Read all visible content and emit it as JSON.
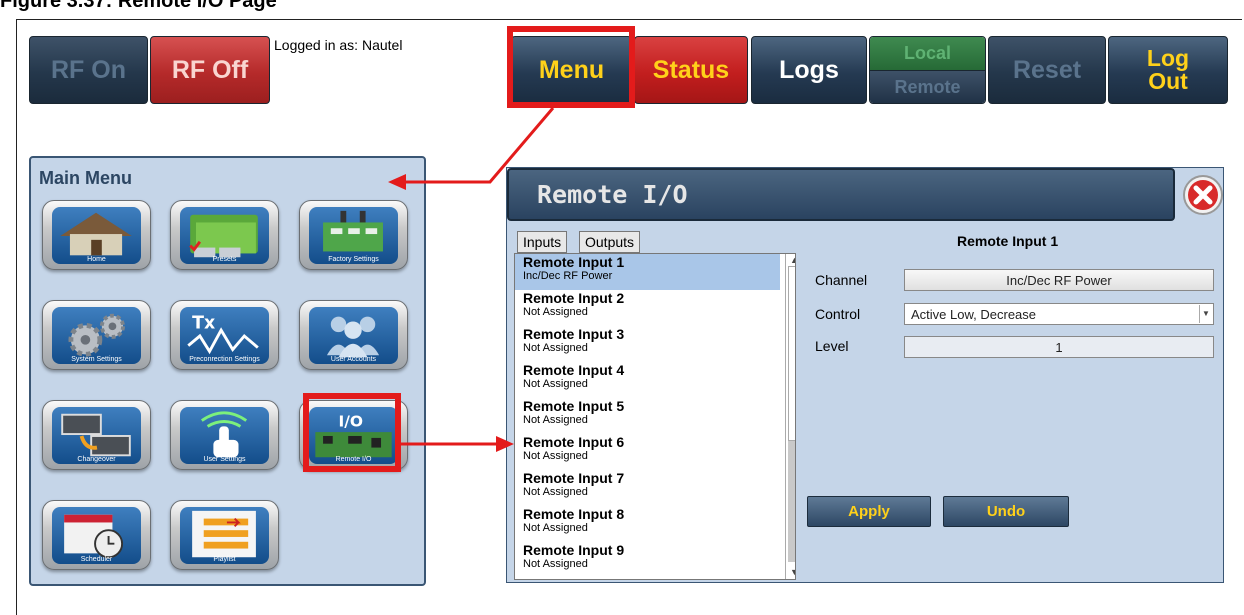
{
  "caption": "Figure 3.37: Remote I/O Page",
  "toolbar": {
    "rf_on": "RF On",
    "rf_off": "RF Off",
    "logged_in": "Logged in as: Nautel",
    "menu": "Menu",
    "status": "Status",
    "logs": "Logs",
    "local": "Local",
    "remote": "Remote",
    "reset": "Reset",
    "logout": "Log Out"
  },
  "main_menu": {
    "title": "Main Menu",
    "tiles": [
      "Home",
      "Presets",
      "Factory Settings",
      "System Settings",
      "Preconrection Settings",
      "User Accounts",
      "Changeover",
      "User Settings",
      "Remote I/O",
      "Scheduler",
      "Playlist"
    ],
    "icon_text": {
      "txi": "Tx",
      "io": "I/O"
    }
  },
  "remote_io": {
    "title": "Remote I/O",
    "tabs": {
      "inputs": "Inputs",
      "outputs": "Outputs"
    },
    "items": [
      {
        "name": "Remote Input 1",
        "sub": "Inc/Dec RF Power"
      },
      {
        "name": "Remote Input 2",
        "sub": "Not Assigned"
      },
      {
        "name": "Remote Input 3",
        "sub": "Not Assigned"
      },
      {
        "name": "Remote Input 4",
        "sub": "Not Assigned"
      },
      {
        "name": "Remote Input 5",
        "sub": "Not Assigned"
      },
      {
        "name": "Remote Input 6",
        "sub": "Not Assigned"
      },
      {
        "name": "Remote Input 7",
        "sub": "Not Assigned"
      },
      {
        "name": "Remote Input 8",
        "sub": "Not Assigned"
      },
      {
        "name": "Remote Input 9",
        "sub": "Not Assigned"
      }
    ],
    "selected": 0,
    "detail": {
      "title": "Remote Input 1",
      "channel_label": "Channel",
      "channel_value": "Inc/Dec RF Power",
      "control_label": "Control",
      "control_value": "Active Low, Decrease",
      "level_label": "Level",
      "level_value": "1",
      "apply": "Apply",
      "undo": "Undo"
    }
  },
  "colors": {
    "highlight": "#e31b1b",
    "panel_bg": "#c5d5e8",
    "accent_yellow": "#ffd11a"
  }
}
